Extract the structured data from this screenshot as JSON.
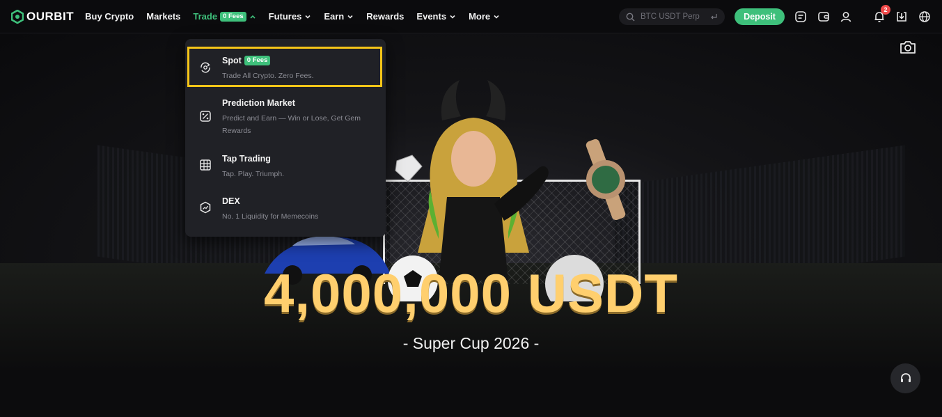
{
  "header": {
    "logo_text": "OURBIT",
    "nav": [
      {
        "label": "Buy Crypto"
      },
      {
        "label": "Markets"
      },
      {
        "label": "Trade",
        "badge": "0 Fees",
        "active": true
      },
      {
        "label": "Futures"
      },
      {
        "label": "Earn"
      },
      {
        "label": "Rewards"
      },
      {
        "label": "Events"
      },
      {
        "label": "More"
      }
    ],
    "search_placeholder": "BTC USDT Perp",
    "deposit_label": "Deposit",
    "notification_count": "2",
    "icons": [
      "search-icon",
      "orders-icon",
      "wallet-icon",
      "user-icon",
      "bell-icon",
      "download-icon",
      "globe-icon"
    ]
  },
  "trade_menu": {
    "items": [
      {
        "title": "Spot",
        "badge": "0 Fees",
        "desc": "Trade All Crypto. Zero Fees."
      },
      {
        "title": "Prediction Market",
        "desc": "Predict and Earn — Win or Lose, Get Gem Rewards"
      },
      {
        "title": "Tap Trading",
        "desc": "Tap. Play. Triumph."
      },
      {
        "title": "DEX",
        "desc": "No. 1 Liquidity for Memecoins"
      }
    ]
  },
  "hero": {
    "headline": "4,000,000 USDT",
    "subline": "- Super Cup 2026 -"
  },
  "colors": {
    "accent_green": "#3ec07b",
    "headline_gold": "#ffcf6e",
    "highlight_yellow": "#f5c518",
    "badge_red": "#f04a4a"
  }
}
